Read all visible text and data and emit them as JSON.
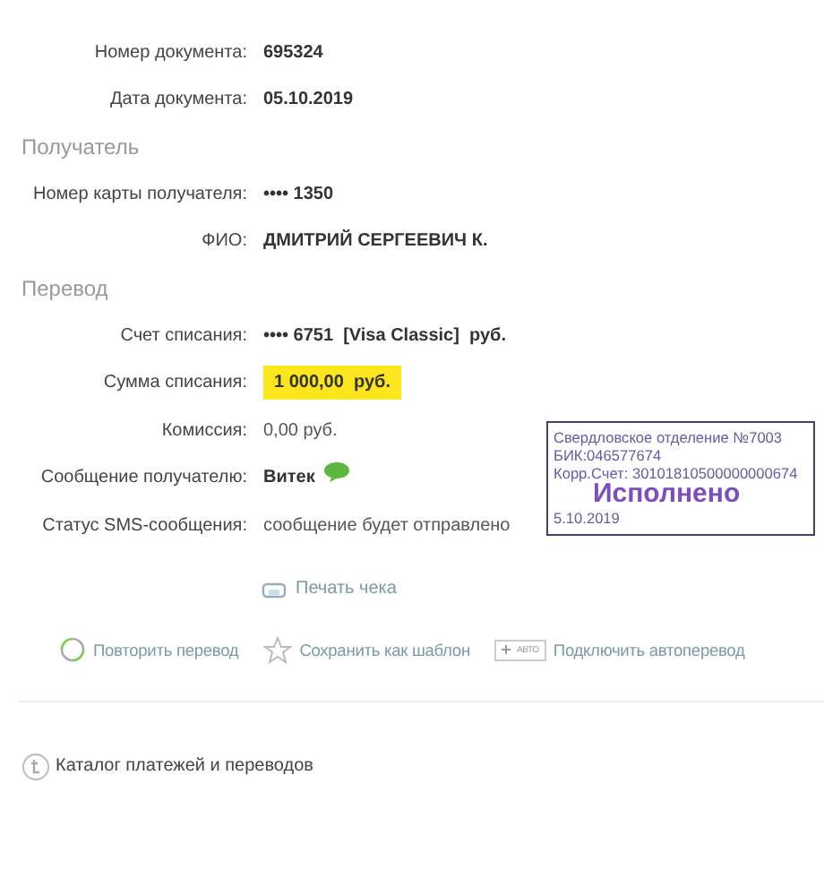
{
  "sections": [
    {
      "rows": [
        {
          "label": "Номер документа:",
          "value": "695324",
          "kind": "bold"
        },
        {
          "label": "Дата документа:",
          "value": "05.10.2019",
          "kind": "bold"
        }
      ]
    },
    {
      "heading": "Получатель",
      "rows": [
        {
          "label": "Номер карты получателя:",
          "value": "•••• 1350",
          "kind": "bold"
        },
        {
          "label": "ФИО:",
          "value": "ДМИТРИЙ СЕРГЕЕВИЧ К.",
          "kind": "bold"
        }
      ]
    },
    {
      "heading": "Перевод",
      "rows": [
        {
          "label": "Счет списания:",
          "value": "•••• 6751  [Visa Classic]  руб.",
          "kind": "bold"
        },
        {
          "label": "Сумма списания:",
          "value": "1 000,00  руб.",
          "kind": "highlight"
        },
        {
          "label": "Комиссия:",
          "value": "0,00 руб.",
          "kind": "plain"
        },
        {
          "label": "Сообщение получателю:",
          "value": "Витек",
          "kind": "sms"
        },
        {
          "label": "Статус SMS-сообщения:",
          "value": "сообщение будет отправлено",
          "kind": "plain"
        }
      ]
    }
  ],
  "print_link": "Печать чека",
  "actions": [
    {
      "kind": "repeat",
      "label": "Повторить перевод"
    },
    {
      "kind": "template",
      "label": "Сохранить как шаблон"
    },
    {
      "kind": "auto",
      "badge": "АВТО",
      "label": "Подключить автоперевод"
    }
  ],
  "catalog_link": "Каталог платежей и переводов",
  "stamp": {
    "lines": [
      "Свердловское отделение №7003",
      "БИК:046577674",
      "Корр.Счет: 30101810500000000674"
    ],
    "status": "Исполнено",
    "date": "5.10.2019"
  }
}
